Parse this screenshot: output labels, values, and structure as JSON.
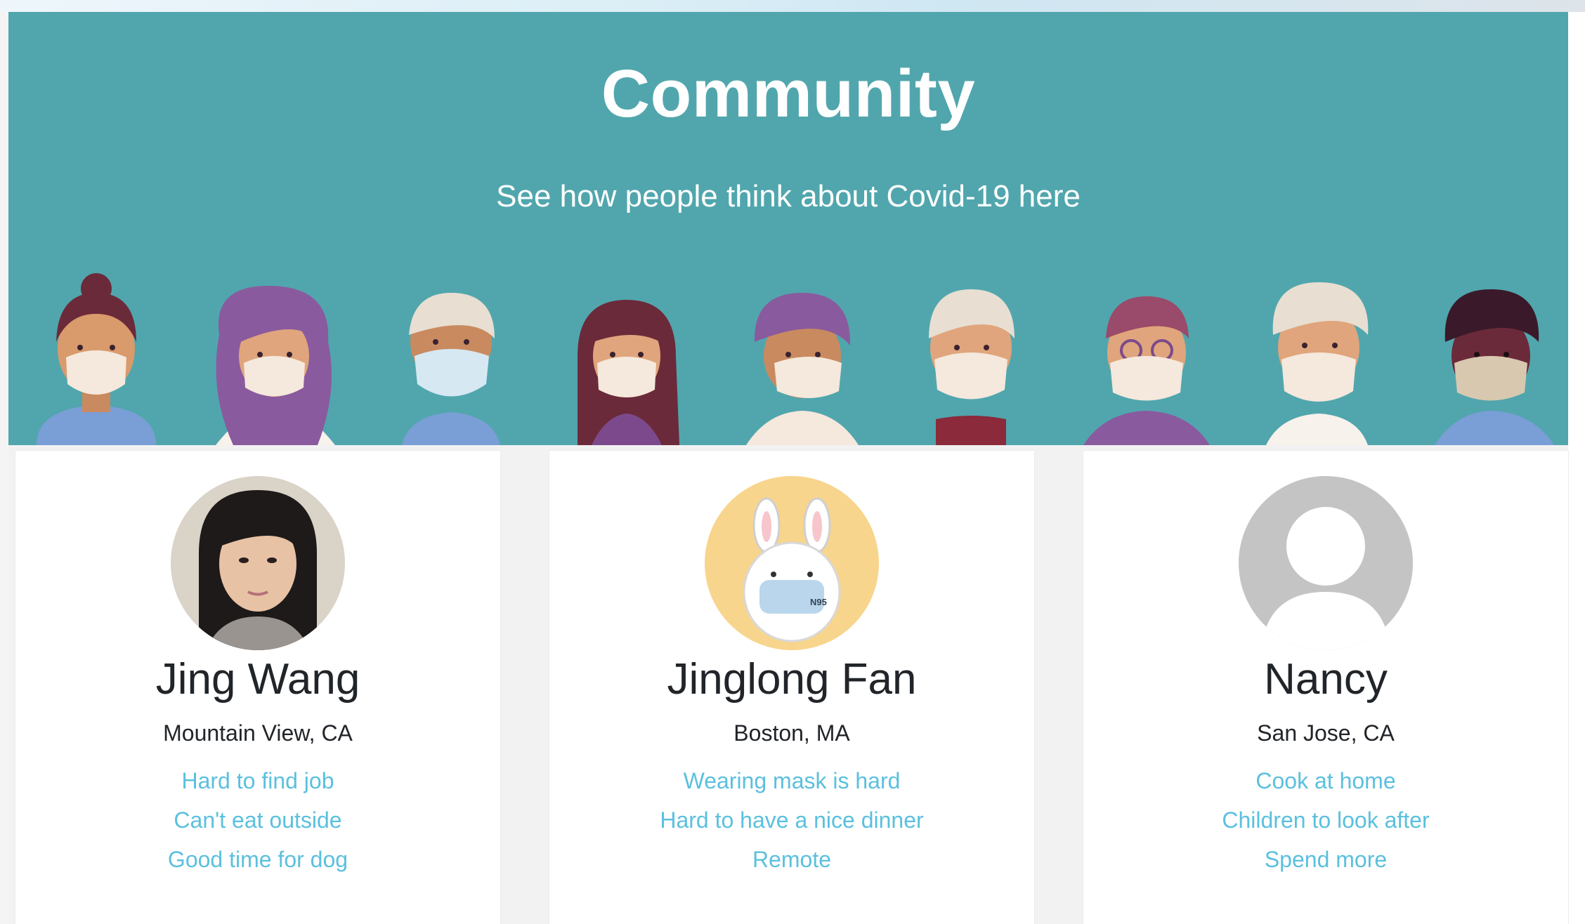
{
  "hero": {
    "title": "Community",
    "subtitle": "See how people think about Covid-19 here",
    "background_color": "#51a6ad"
  },
  "profiles": [
    {
      "name": "Jing Wang",
      "location": "Mountain View, CA",
      "avatar": "photo-avatar",
      "thoughts": [
        "Hard to find job",
        "Can't eat outside",
        "Good time for dog"
      ]
    },
    {
      "name": "Jinglong Fan",
      "location": "Boston, MA",
      "avatar": "bunny-mask-avatar",
      "avatar_mask_text": "N95",
      "thoughts": [
        "Wearing mask is hard",
        "Hard to have a nice dinner",
        "Remote"
      ]
    },
    {
      "name": "Nancy",
      "location": "San Jose, CA",
      "avatar": "default-user-icon",
      "thoughts": [
        "Cook at home",
        "Children to look after",
        "Spend more"
      ]
    }
  ],
  "colors": {
    "link": "#5bc0de",
    "text": "#212529"
  }
}
